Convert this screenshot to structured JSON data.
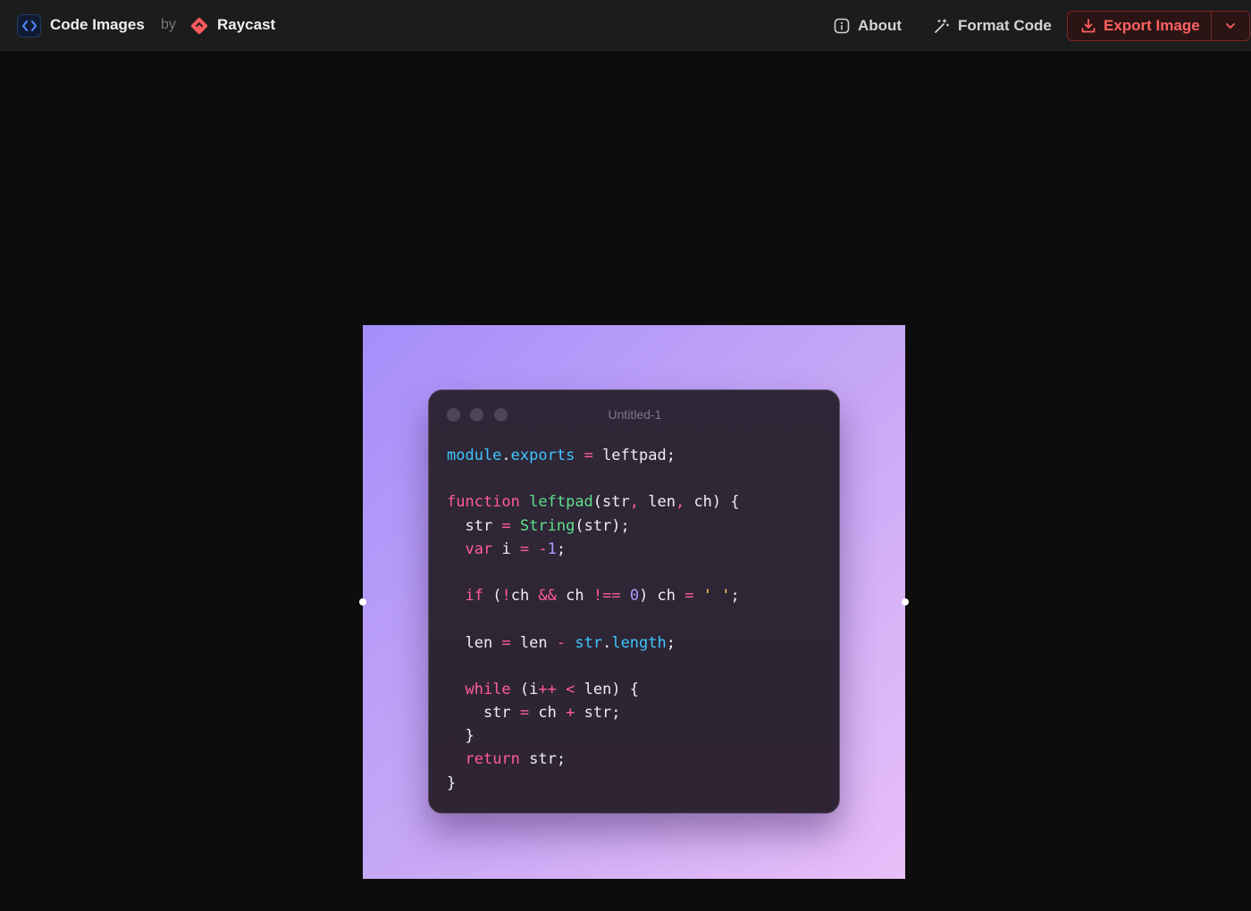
{
  "app": {
    "title": "Code Images",
    "by": "by",
    "partner": "Raycast"
  },
  "toolbar": {
    "about_label": "About",
    "format_label": "Format Code",
    "export_label": "Export Image"
  },
  "colors": {
    "accent": "#ff6161",
    "frame_gradient_start": "#a58efb",
    "frame_gradient_end": "#e9bff8",
    "window_bg": "#2f2737"
  },
  "icons": {
    "brand": "code-brackets-icon",
    "partner": "raycast-logo-icon",
    "about": "info-icon",
    "format": "magic-wand-icon",
    "export": "download-icon",
    "export_dropdown": "chevron-down-icon"
  },
  "editor": {
    "window_title": "Untitled-1",
    "lines": [
      [
        [
          "module",
          "prop"
        ],
        [
          ".",
          ""
        ],
        [
          "exports",
          "prop"
        ],
        [
          " ",
          ""
        ],
        [
          "=",
          "op"
        ],
        [
          " leftpad;",
          ""
        ]
      ],
      [],
      [
        [
          "function",
          "kw"
        ],
        [
          " ",
          ""
        ],
        [
          "leftpad",
          "fn"
        ],
        [
          "(str",
          ""
        ],
        [
          ",",
          "op"
        ],
        [
          " len",
          ""
        ],
        [
          ",",
          "op"
        ],
        [
          " ch) {",
          ""
        ]
      ],
      [
        [
          "  str ",
          ""
        ],
        [
          "=",
          "op"
        ],
        [
          " ",
          ""
        ],
        [
          "String",
          "fn"
        ],
        [
          "(str);",
          ""
        ]
      ],
      [
        [
          "  ",
          ""
        ],
        [
          "var",
          "kw"
        ],
        [
          " i ",
          ""
        ],
        [
          "=",
          "op"
        ],
        [
          " ",
          ""
        ],
        [
          "-",
          "op"
        ],
        [
          "1",
          "num"
        ],
        [
          ";",
          ""
        ]
      ],
      [],
      [
        [
          "  ",
          ""
        ],
        [
          "if",
          "kw"
        ],
        [
          " (",
          ""
        ],
        [
          "!",
          "op"
        ],
        [
          "ch ",
          ""
        ],
        [
          "&&",
          "op"
        ],
        [
          " ch ",
          ""
        ],
        [
          "!==",
          "op"
        ],
        [
          " ",
          ""
        ],
        [
          "0",
          "num"
        ],
        [
          ") ch ",
          ""
        ],
        [
          "=",
          "op"
        ],
        [
          " ",
          ""
        ],
        [
          "' '",
          "str"
        ],
        [
          ";",
          ""
        ]
      ],
      [],
      [
        [
          "  len ",
          ""
        ],
        [
          "=",
          "op"
        ],
        [
          " len ",
          ""
        ],
        [
          "-",
          "op"
        ],
        [
          " ",
          ""
        ],
        [
          "str",
          "prop"
        ],
        [
          ".",
          ""
        ],
        [
          "length",
          "prop"
        ],
        [
          ";",
          ""
        ]
      ],
      [],
      [
        [
          "  ",
          ""
        ],
        [
          "while",
          "kw"
        ],
        [
          " (i",
          ""
        ],
        [
          "++",
          "op"
        ],
        [
          " ",
          ""
        ],
        [
          "<",
          "op"
        ],
        [
          " len) {",
          ""
        ]
      ],
      [
        [
          "    str ",
          ""
        ],
        [
          "=",
          "op"
        ],
        [
          " ch ",
          ""
        ],
        [
          "+",
          "op"
        ],
        [
          " str;",
          ""
        ]
      ],
      [
        [
          "  }",
          ""
        ]
      ],
      [
        [
          "  ",
          ""
        ],
        [
          "return",
          "kw"
        ],
        [
          " str;",
          ""
        ]
      ],
      [
        [
          "}",
          ""
        ]
      ]
    ]
  }
}
